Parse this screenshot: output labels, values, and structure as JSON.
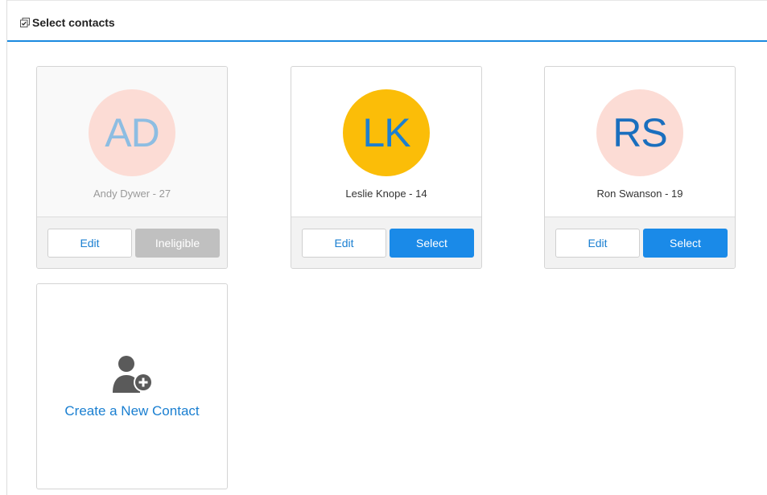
{
  "panel": {
    "title": "Select contacts"
  },
  "contacts": [
    {
      "initials": "AD",
      "name": "Andy Dywer - 27",
      "avatar_bg": "#fcdcd5",
      "initials_color": "#8dbde2",
      "edit_label": "Edit",
      "action_label": "Ineligible",
      "eligible": false
    },
    {
      "initials": "LK",
      "name": "Leslie Knope - 14",
      "avatar_bg": "#fbbd08",
      "initials_color": "#1d7fcf",
      "edit_label": "Edit",
      "action_label": "Select",
      "eligible": true
    },
    {
      "initials": "RS",
      "name": "Ron Swanson - 19",
      "avatar_bg": "#fcdcd5",
      "initials_color": "#1a6fbe",
      "edit_label": "Edit",
      "action_label": "Select",
      "eligible": true
    }
  ],
  "create": {
    "label": "Create a New Contact",
    "icon": "add-user-icon"
  },
  "colors": {
    "accent": "#1a8ae8",
    "disabled": "#c0c0c0"
  }
}
